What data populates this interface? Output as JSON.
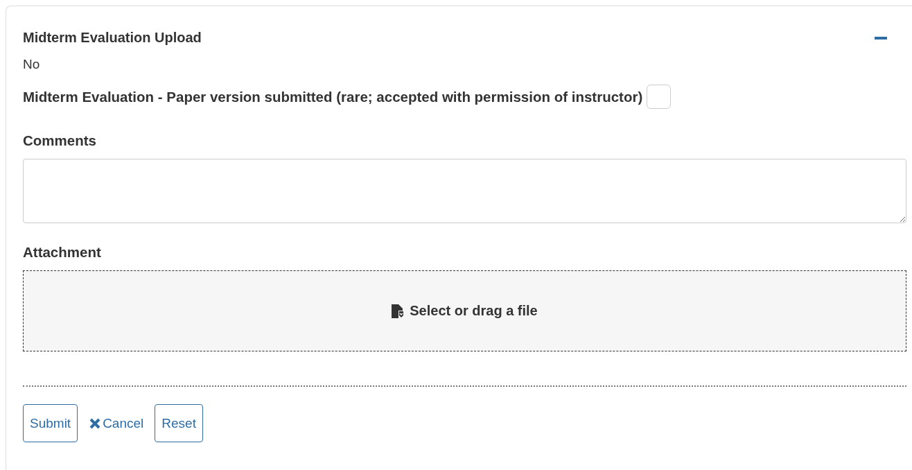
{
  "section": {
    "title": "Midterm Evaluation Upload",
    "expanded": true,
    "value": "No"
  },
  "paper_submitted": {
    "label": "Midterm Evaluation - Paper version submitted (rare; accepted with permission of instructor)",
    "checked": false
  },
  "comments": {
    "label": "Comments"
  },
  "attachment": {
    "label": "Attachment",
    "dropzone_text": "Select or drag a file"
  },
  "buttons": [
    {
      "kind": "outline",
      "label": "Submit"
    },
    {
      "kind": "link",
      "label": "Cancel"
    },
    {
      "kind": "outline",
      "label": "Reset"
    }
  ]
}
